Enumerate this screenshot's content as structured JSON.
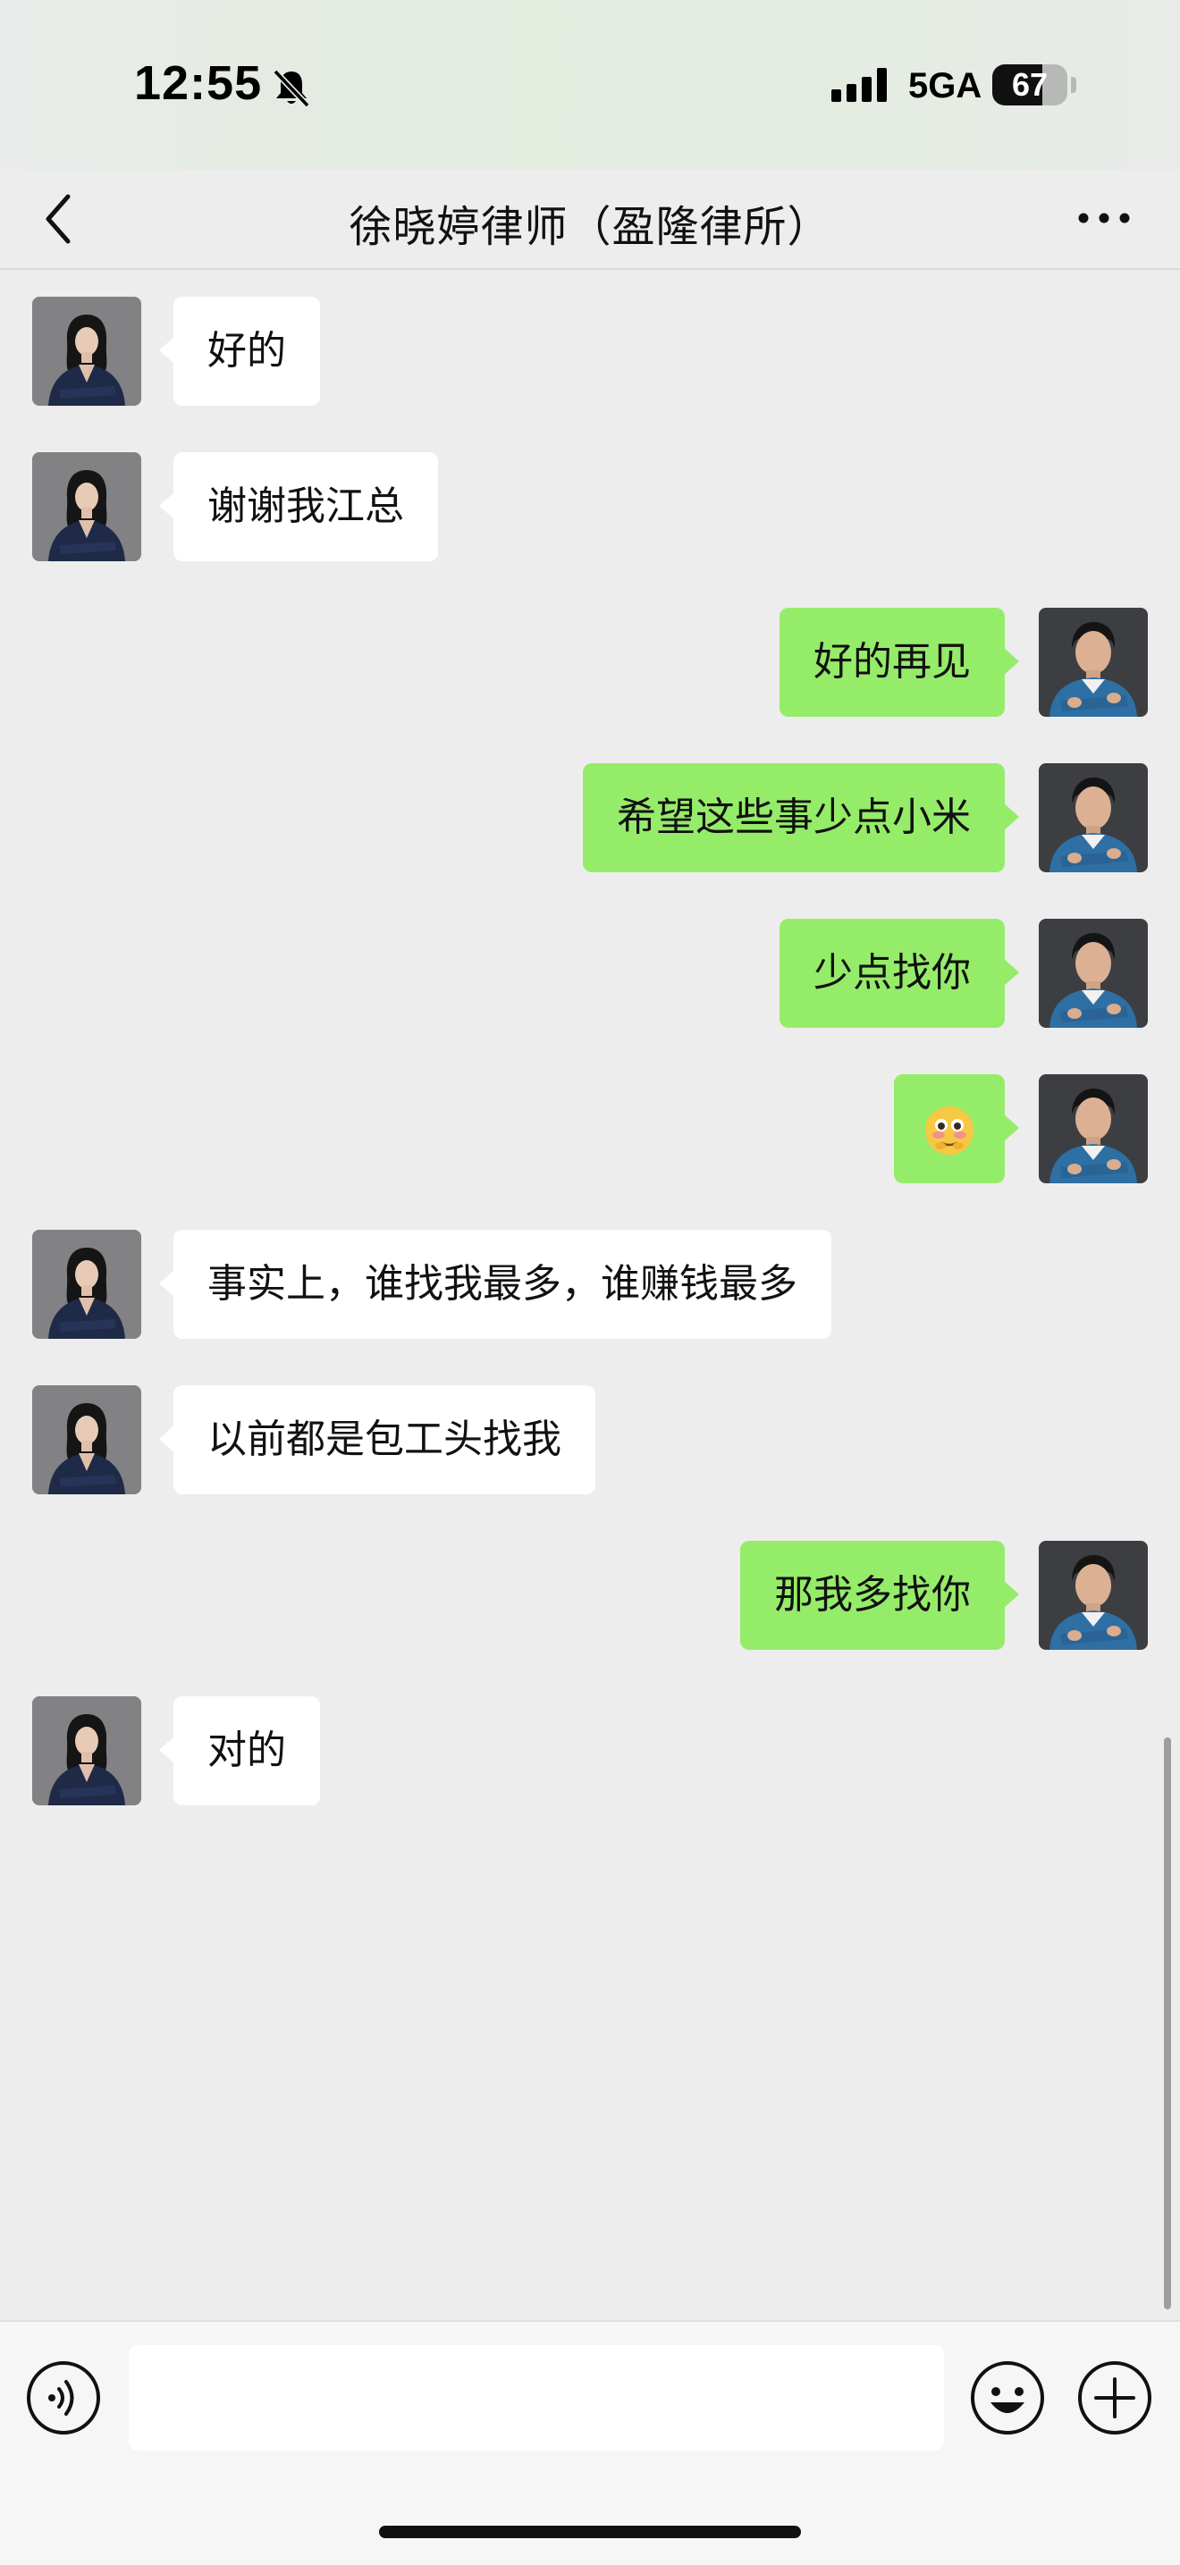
{
  "status_bar": {
    "time": "12:55",
    "network": "5GA",
    "battery": "67",
    "icons": [
      "bell-muted-icon",
      "signal-icon",
      "battery-icon"
    ]
  },
  "nav": {
    "title": "徐晓婷律师（盈隆律所）",
    "icons": [
      "chevron-left-icon",
      "more-icon"
    ]
  },
  "messages": [
    {
      "side": "received",
      "text": "好的"
    },
    {
      "side": "received",
      "text": "谢谢我江总"
    },
    {
      "side": "sent",
      "text": "好的再见"
    },
    {
      "side": "sent",
      "text": "希望这些事少点小米"
    },
    {
      "side": "sent",
      "text": "少点找你"
    },
    {
      "side": "sent",
      "emoji": "blushing-face-emoji"
    },
    {
      "side": "received",
      "text": "事实上，谁找我最多，谁赚钱最多"
    },
    {
      "side": "received",
      "text": "以前都是包工头找我"
    },
    {
      "side": "sent",
      "text": "那我多找你"
    },
    {
      "side": "received",
      "text": "对的"
    }
  ],
  "input_bar": {
    "input_value": "",
    "icons": [
      "voice-icon",
      "emoji-icon",
      "plus-icon"
    ]
  },
  "colors": {
    "chat_background": "#ededed",
    "sent_bubble": "#95ec69",
    "received_bubble": "#ffffff"
  }
}
